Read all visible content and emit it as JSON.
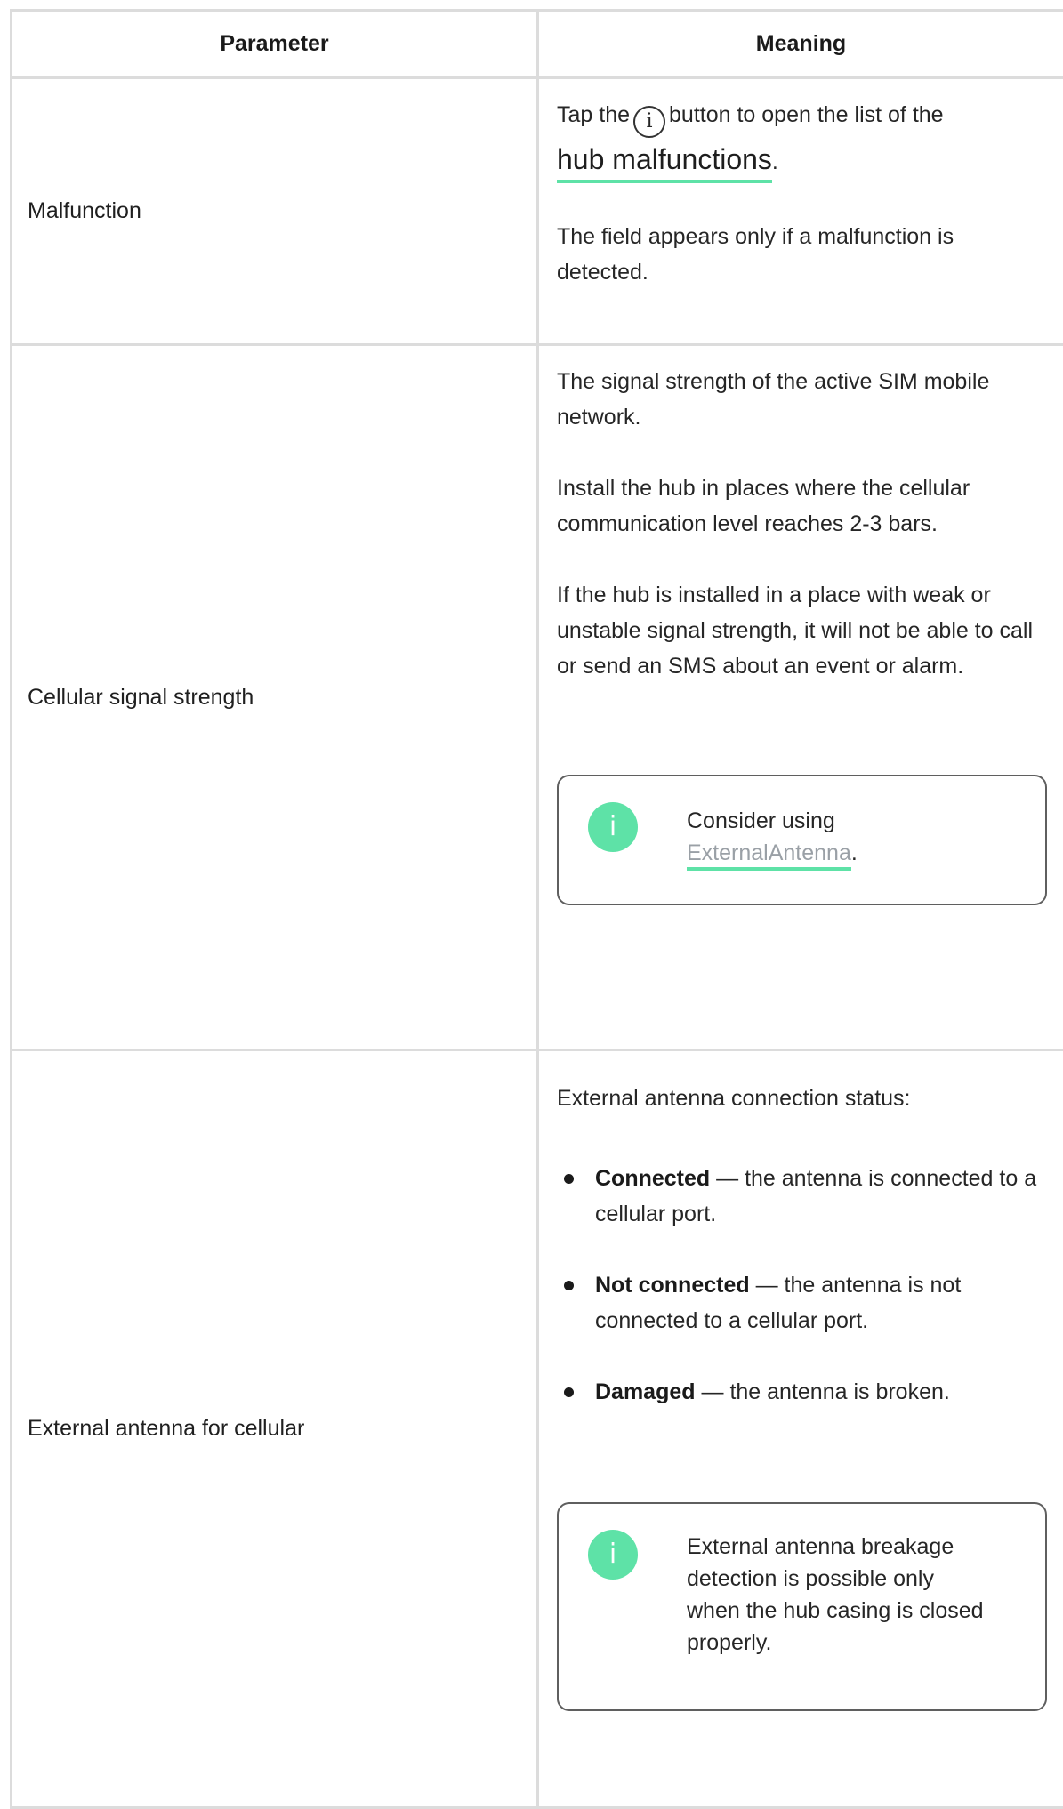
{
  "header": {
    "col1": "Parameter",
    "col2": "Meaning"
  },
  "rows": [
    {
      "param": "Malfunction",
      "tap_prefix": "Tap the",
      "info_glyph": "i",
      "tap_suffix": "button to open the list of the",
      "link_text": "hub malfunctions",
      "link_period": ".",
      "note": "The field appears only if a malfunction is detected."
    },
    {
      "param": "Cellular signal strength",
      "p1": "The signal strength of the active SIM mobile network.",
      "p2": "Install the hub in places where the cellular communication level reaches 2-3 bars.",
      "p3": "If the hub is installed in a place with weak or unstable signal strength, it will not be able to call or send an SMS about an event or alarm.",
      "callout_icon": "i",
      "callout_prefix": "Consider using",
      "callout_link": "ExternalAntenna",
      "callout_period": "."
    },
    {
      "param": "External antenna for cellular",
      "intro": "External antenna connection status:",
      "items": [
        {
          "term": "Connected",
          "desc": " — the antenna is connected to a cellular port."
        },
        {
          "term": "Not connected",
          "desc": " — the antenna is not connected to a cellular port."
        },
        {
          "term": "Damaged",
          "desc": " — the antenna is broken."
        }
      ],
      "callout_icon": "i",
      "callout_text": "External antenna breakage detection is possible only when the hub casing is closed properly."
    }
  ],
  "colors": {
    "accent": "#5ee2a7",
    "border": "#dcdcdc",
    "link_gray": "#9aa0a6"
  }
}
